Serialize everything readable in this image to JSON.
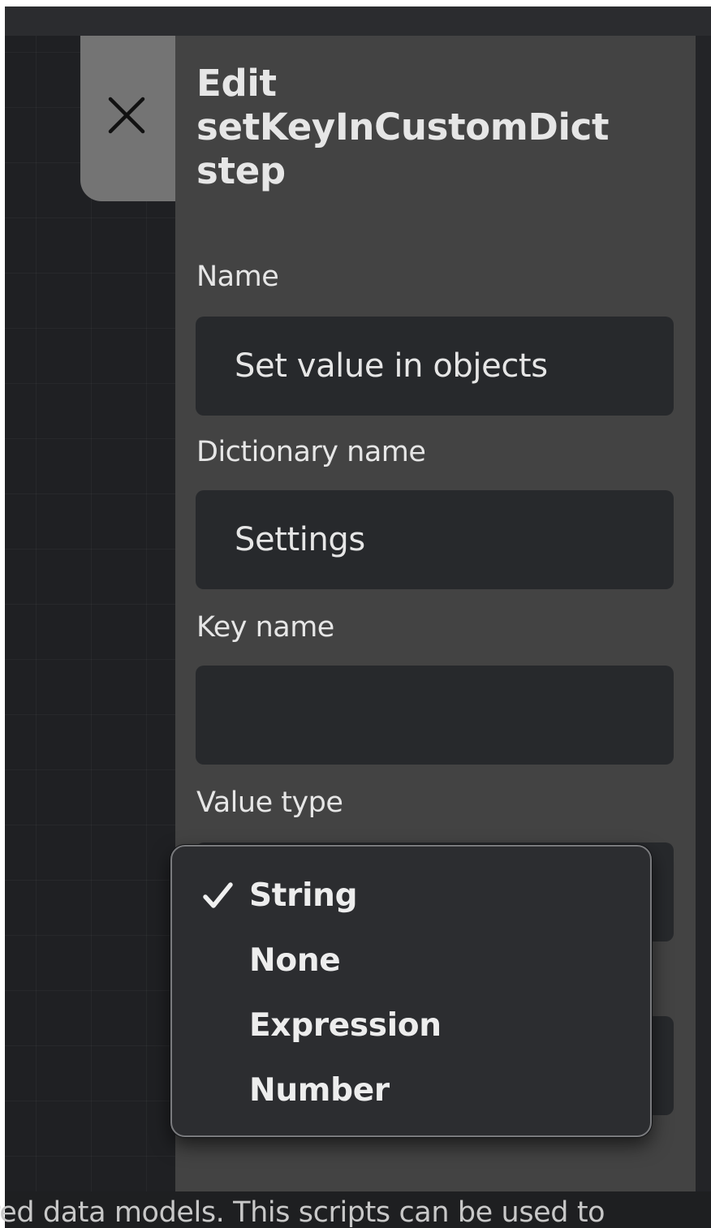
{
  "panel": {
    "title": "Edit setKeyInCustomDict step",
    "close_icon": "close-icon",
    "fields": {
      "name": {
        "label": "Name",
        "value": "Set value in objects"
      },
      "dictionary_name": {
        "label": "Dictionary name",
        "value": "Settings"
      },
      "key_name": {
        "label": "Key name",
        "value": ""
      },
      "value_type": {
        "label": "Value type",
        "selected": "String"
      }
    }
  },
  "dropdown": {
    "options": [
      {
        "label": "String",
        "selected": true,
        "icon": "checkmark-icon"
      },
      {
        "label": "None",
        "selected": false
      },
      {
        "label": "Expression",
        "selected": false
      },
      {
        "label": "Number",
        "selected": false
      }
    ]
  },
  "background": {
    "footer_text": "red data models. This scripts can be used to"
  }
}
